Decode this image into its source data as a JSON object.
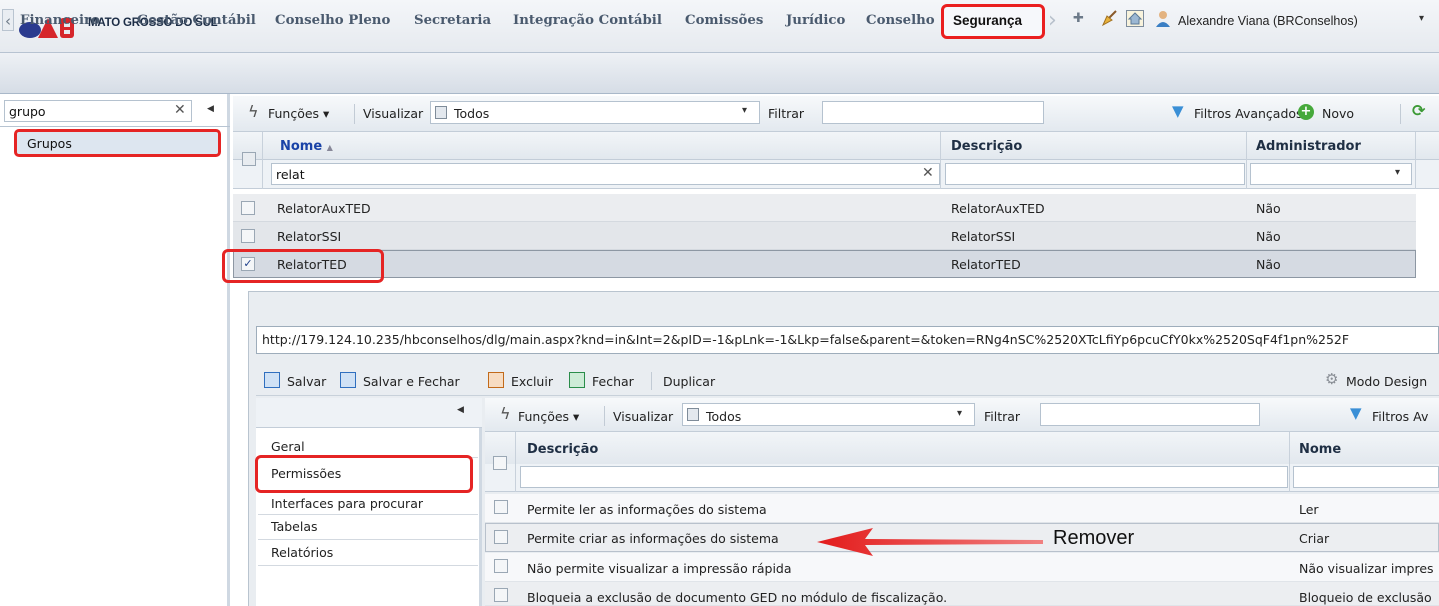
{
  "header": {
    "org_name": "MATO GROSSO DO SUL",
    "brand_colors": {
      "logo_blue": "#2b3b8f",
      "logo_red": "#d6262b"
    }
  },
  "nav": {
    "items": [
      "Financeiro",
      "Gestão Contábil",
      "Conselho Pleno",
      "Secretaria",
      "Integração Contábil",
      "Comissões",
      "Jurídico",
      "Conselho"
    ],
    "active": "Segurança",
    "user_name": "Alexandre Viana (BRConselhos)",
    "icons": [
      "pin-icon",
      "broom-icon",
      "home-icon",
      "user-icon",
      "caret-down-icon"
    ]
  },
  "left_panel": {
    "search_value": "grupo",
    "tree_items": [
      "Grupos"
    ]
  },
  "toolbar": {
    "functions_label": "Funções",
    "view_label": "Visualizar",
    "view_value": "Todos",
    "filter_label": "Filtrar",
    "advanced_filters_label": "Filtros Avançados",
    "new_label": "Novo"
  },
  "grid": {
    "columns": [
      "Nome",
      "Descrição",
      "Administrador"
    ],
    "sort_indicator": "▲",
    "filter_nome_value": "relat",
    "rows": [
      {
        "nome": "RelatorAuxTED",
        "descricao": "RelatorAuxTED",
        "admin": "Não",
        "checked": false
      },
      {
        "nome": "RelatorSSI",
        "descricao": "RelatorSSI",
        "admin": "Não",
        "checked": false
      },
      {
        "nome": "RelatorTED",
        "descricao": "RelatorTED",
        "admin": "Não",
        "checked": true
      }
    ]
  },
  "dialog": {
    "url": "http://179.124.10.235/hbconselhos/dlg/main.aspx?knd=in&Int=2&pID=-1&pLnk=-1&Lkp=false&parent=&token=RNg4nSC%2520XTcLfiYp6pcuCfY0kx%2520SqF4f1pn%252F",
    "toolbar": {
      "save": "Salvar",
      "save_close": "Salvar e Fechar",
      "delete": "Excluir",
      "close": "Fechar",
      "duplicate": "Duplicar",
      "design_mode": "Modo Design"
    },
    "nav_items": [
      "Geral",
      "Permissões",
      "Interfaces para procurar",
      "Tabelas",
      "Relatórios"
    ],
    "sub_toolbar": {
      "functions_label": "Funções",
      "view_label": "Visualizar",
      "view_value": "Todos",
      "filter_label": "Filtrar",
      "advanced_filters_label": "Filtros Av"
    },
    "grid": {
      "columns": [
        "Descrição",
        "Nome"
      ],
      "rows": [
        {
          "descricao": "Permite ler as informações do sistema",
          "nome": "Ler"
        },
        {
          "descricao": "Permite criar as informações do sistema",
          "nome": "Criar"
        },
        {
          "descricao": "Não permite visualizar a impressão rápida",
          "nome": "Não visualizar impres"
        },
        {
          "descricao": "Bloqueia a exclusão de documento GED no módulo de fiscalização.",
          "nome": "Bloqueio de exclusão"
        }
      ]
    }
  },
  "annotation": {
    "label": "Remover",
    "color": "#e52424"
  }
}
